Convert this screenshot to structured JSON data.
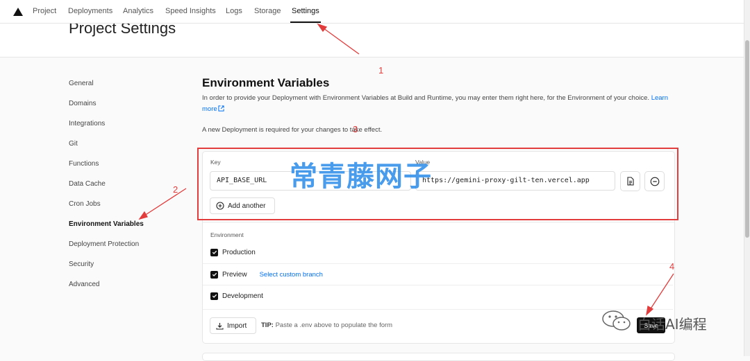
{
  "nav": {
    "tabs": [
      {
        "label": "Project"
      },
      {
        "label": "Deployments"
      },
      {
        "label": "Analytics"
      },
      {
        "label": "Speed Insights"
      },
      {
        "label": "Logs"
      },
      {
        "label": "Storage"
      },
      {
        "label": "Settings",
        "active": true
      }
    ]
  },
  "page": {
    "title": "Project Settings"
  },
  "sidebar": {
    "items": [
      {
        "label": "General"
      },
      {
        "label": "Domains"
      },
      {
        "label": "Integrations"
      },
      {
        "label": "Git"
      },
      {
        "label": "Functions"
      },
      {
        "label": "Data Cache"
      },
      {
        "label": "Cron Jobs"
      },
      {
        "label": "Environment Variables",
        "active": true
      },
      {
        "label": "Deployment Protection"
      },
      {
        "label": "Security"
      },
      {
        "label": "Advanced"
      }
    ]
  },
  "env": {
    "title": "Environment Variables",
    "description": "In order to provide your Deployment with Environment Variables at Build and Runtime, you may enter them right here, for the Environment of your choice.",
    "learn_more": "Learn more",
    "note": "A new Deployment is required for your changes to take effect.",
    "key_label": "Key",
    "value_label": "Value",
    "key_value": "API_BASE_URL",
    "value_value": "https://gemini-proxy-gilt-ten.vercel.app",
    "add_another": "Add another",
    "environment_label": "Environment",
    "options": [
      {
        "label": "Production",
        "checked": true
      },
      {
        "label": "Preview",
        "checked": true,
        "link": "Select custom branch"
      },
      {
        "label": "Development",
        "checked": true
      }
    ],
    "import": "Import",
    "tip_label": "TIP:",
    "tip_text": "Paste a .env above to populate the form",
    "save": "Save"
  },
  "annotations": {
    "numbers": [
      "1",
      "2",
      "3",
      "4"
    ],
    "watermark": "常青藤网子",
    "brand": "白话AI编程",
    "color": "#e23c3c"
  }
}
